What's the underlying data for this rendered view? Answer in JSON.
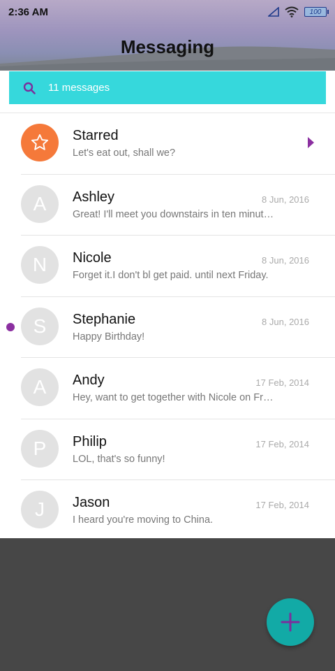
{
  "status_bar": {
    "time": "2:36 AM",
    "battery": "100"
  },
  "header": {
    "title": "Messaging"
  },
  "search": {
    "text": "11 messages"
  },
  "conversations": [
    {
      "name": "Starred",
      "preview": "Let's eat out, shall we?",
      "date": "",
      "initial": ""
    },
    {
      "name": "Ashley",
      "preview": "Great! I'll meet you downstairs in ten minutes.",
      "date": "8 Jun, 2016",
      "initial": "A"
    },
    {
      "name": "Nicole",
      "preview": "Forget it.I don't bl get paid. until next Friday.",
      "date": "8 Jun, 2016",
      "initial": "N"
    },
    {
      "name": "Stephanie",
      "preview": "Happy Birthday!",
      "date": "8 Jun, 2016",
      "initial": "S"
    },
    {
      "name": "Andy",
      "preview": "Hey, want to get together with Nicole on Friday?",
      "date": "17 Feb, 2014",
      "initial": "A"
    },
    {
      "name": "Philip",
      "preview": "LOL, that's so funny!",
      "date": "17 Feb, 2014",
      "initial": "P"
    },
    {
      "name": "Jason",
      "preview": "I heard you're moving to China.",
      "date": "17 Feb, 2014",
      "initial": "J"
    }
  ],
  "colors": {
    "accent": "#36d8dc",
    "fab": "#12aaa6",
    "purple": "#8b2fa0",
    "starred": "#f5793a"
  }
}
